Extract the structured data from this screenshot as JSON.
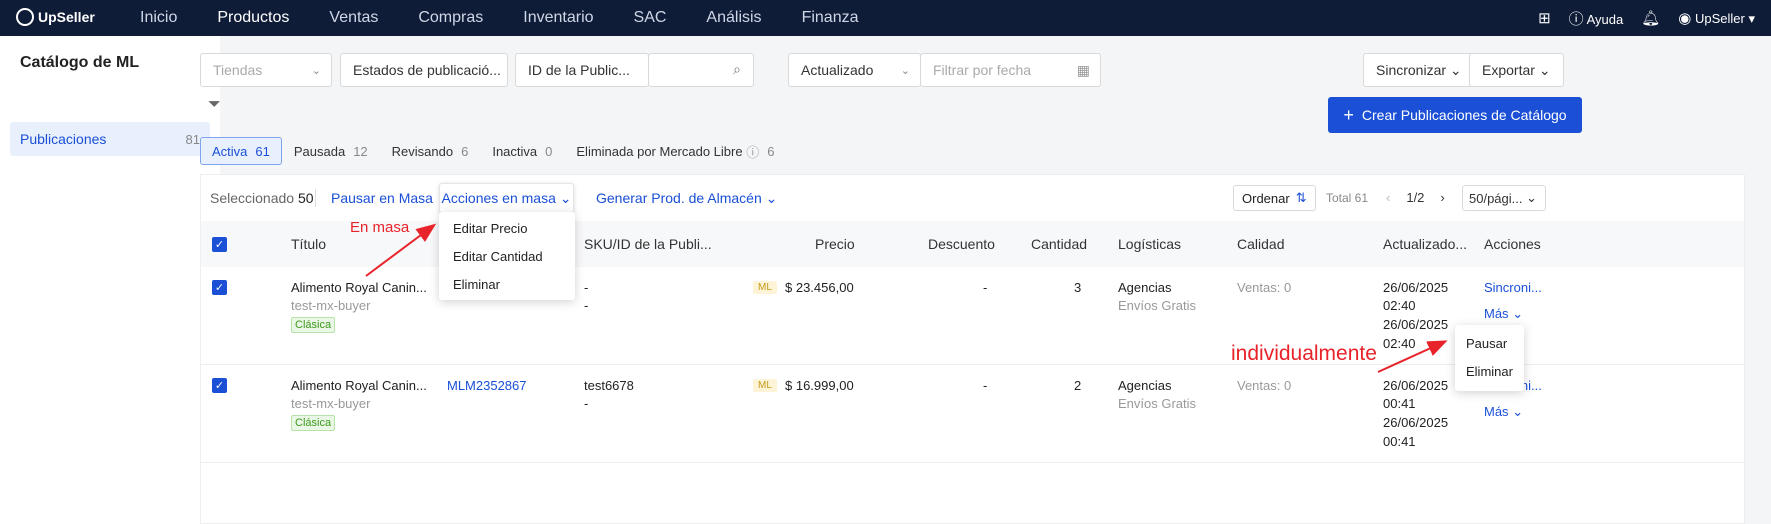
{
  "topbar": {
    "logo": "UpSeller",
    "nav": [
      "Inicio",
      "Productos",
      "Ventas",
      "Compras",
      "Inventario",
      "SAC",
      "Análisis",
      "Finanza"
    ],
    "active_nav": "Productos",
    "help": "Ayuda",
    "user": "UpSeller"
  },
  "sidebar": {
    "title": "Catálogo de ML",
    "item_label": "Publicaciones",
    "item_count": "81"
  },
  "filters": {
    "tiendas": "Tiendas",
    "estados": "Estados de publicació...",
    "id_field": "ID de la Public...",
    "actualizado": "Actualizado",
    "fecha_placeholder": "Filtrar por fecha",
    "sincronizar": "Sincronizar",
    "exportar": "Exportar",
    "crear": "Crear Publicaciones de Catálogo"
  },
  "tabs": [
    {
      "label": "Activa",
      "count": "61"
    },
    {
      "label": "Pausada",
      "count": "12"
    },
    {
      "label": "Revisando",
      "count": "6"
    },
    {
      "label": "Inactiva",
      "count": "0"
    },
    {
      "label": "Eliminada por Mercado Libre",
      "count": "6"
    }
  ],
  "toolbar": {
    "selected_label": "Seleccionado",
    "selected_count": "50",
    "pausar": "Pausar en Masa",
    "acciones": "Acciones en masa",
    "generar": "Generar Prod. de Almacén",
    "ordenar": "Ordenar",
    "total": "Total 61",
    "page": "1/2",
    "per_page": "50/pági..."
  },
  "columns": [
    "Título",
    "SKU/ID de la Publi...",
    "Precio",
    "Descuento",
    "Cantidad",
    "Logísticas",
    "Calidad",
    "Actualizado...",
    "Acciones"
  ],
  "rows": [
    {
      "title": "Alimento Royal Canin...",
      "buyer": "test-mx-buyer",
      "type": "Clásica",
      "id": "",
      "sku": "-",
      "sku2": "-",
      "ml": "ML",
      "price": "$ 23.456,00",
      "discount": "-",
      "qty": "3",
      "log": "Agencias",
      "log2": "Envíos Gratis",
      "sales": "Ventas: 0",
      "date1": "26/06/2025",
      "time1": "02:40",
      "date2": "26/06/2025",
      "time2": "02:40",
      "action": "Sincroni...",
      "more": "Más"
    },
    {
      "title": "Alimento Royal Canin...",
      "buyer": "test-mx-buyer",
      "type": "Clásica",
      "id": "MLM2352867",
      "sku": "test6678",
      "sku2": "-",
      "ml": "ML",
      "price": "$ 16.999,00",
      "discount": "-",
      "qty": "2",
      "log": "Agencias",
      "log2": "Envíos Gratis",
      "sales": "Ventas: 0",
      "date1": "26/06/2025",
      "time1": "00:41",
      "date2": "26/06/2025",
      "time2": "00:41",
      "action": "Sincroni...",
      "more": "Más"
    }
  ],
  "bulk_menu": [
    "Editar Precio",
    "Editar Cantidad",
    "Eliminar"
  ],
  "row_menu": [
    "Pausar",
    "Eliminar"
  ],
  "annotations": {
    "masa": "En masa",
    "individual": "individualmente"
  },
  "colors": {
    "accent": "#1a4fd6",
    "topbar": "#0f1c38",
    "annotation": "#e8232a"
  }
}
